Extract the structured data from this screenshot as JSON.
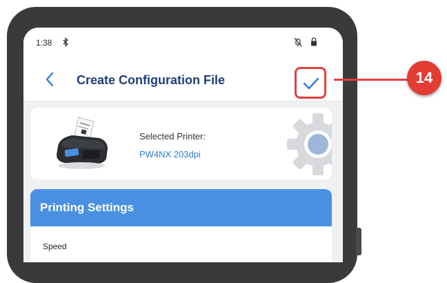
{
  "status_bar": {
    "time": "1:38"
  },
  "app_bar": {
    "title": "Create Configuration File",
    "back_icon": "chevron-left-icon",
    "confirm_icon": "checkmark-icon"
  },
  "printer": {
    "label": "Selected Printer:",
    "name": "PW4NX 203dpi"
  },
  "settings": {
    "title": "Printing Settings",
    "first_field_label": "Speed"
  },
  "callout": {
    "number": "14"
  },
  "colors": {
    "accent_blue": "#4a90e2",
    "title_blue": "#1f3f7a",
    "link_blue": "#2a7fd4",
    "callout_red": "#e23c33"
  }
}
